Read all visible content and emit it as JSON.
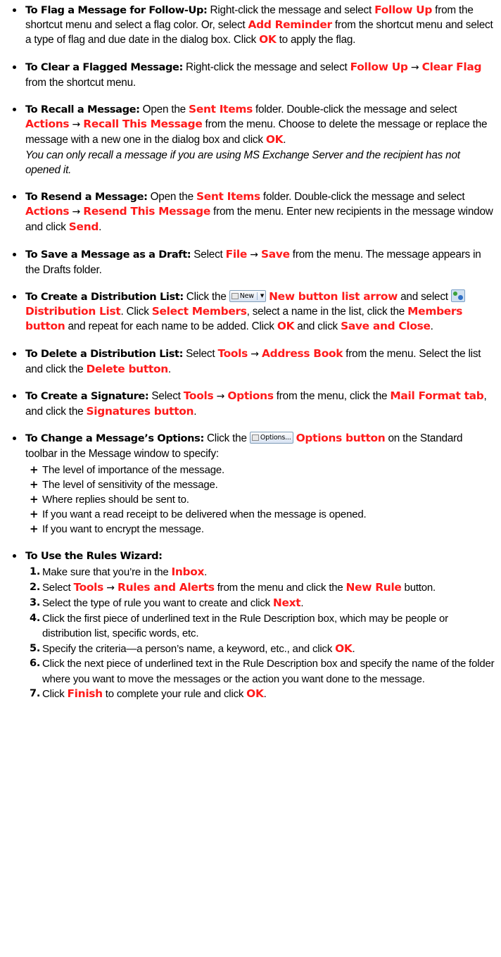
{
  "colors": {
    "highlight": "#ff1a1a",
    "text": "#000000"
  },
  "tips": {
    "flag": {
      "title": "To Flag a Message for Follow-Up:",
      "t1": " Right-click the message and select ",
      "h1": "Follow Up",
      "t2": " from the shortcut menu and select a flag color. Or, select ",
      "h2": "Add Reminder",
      "t3": " from the shortcut menu and select a type of flag and due date in the dialog box. Click ",
      "h3": "OK",
      "t4": " to apply the flag."
    },
    "clear": {
      "title": "To Clear a Flagged Message:",
      "t1": " Right-click the message and select ",
      "h1": "Follow Up",
      "arrow": " → ",
      "h2": "Clear Flag",
      "t2": " from the shortcut menu."
    },
    "recall": {
      "title": "To Recall a Message:",
      "t1": " Open the ",
      "h1": "Sent Items",
      "t2": " folder. Double-click the message and select ",
      "h2": "Actions",
      "arrow": " → ",
      "h3": "Recall This Message",
      "t3": " from the menu. Choose to delete the message or replace the message with a new one in the dialog box and click ",
      "h4": "OK",
      "t4": ".",
      "note": "You can only recall a message if you are using MS Exchange Server and the recipient has not opened it."
    },
    "resend": {
      "title": "To Resend a Message:",
      "t1": " Open the ",
      "h1": "Sent Items",
      "t2": " folder. Double-click the message and select ",
      "h2": "Actions",
      "arrow": " → ",
      "h3": "Resend This Message",
      "t3": " from the menu. Enter new recipients in the message window and click ",
      "h4": "Send",
      "t4": "."
    },
    "draft": {
      "title": "To Save a Message as a Draft:",
      "t1": " Select ",
      "h1": "File",
      "arrow": " → ",
      "h2": "Save",
      "t2": " from the menu. The message appears in the Drafts folder."
    },
    "createdl": {
      "title": "To Create a Distribution List:",
      "t1": " Click the ",
      "newbtn": "New",
      "h1": "New button list arrow",
      "t2": " and select ",
      "h2": "Distribution List",
      "t3": ". Click ",
      "h3": "Select Members",
      "t4": ", select a name in the list, click the ",
      "h4": "Members button",
      "t5": " and repeat for each name to be added. Click ",
      "h5": "OK",
      "t6": " and click ",
      "h6": "Save and Close",
      "t7": "."
    },
    "deletedl": {
      "title": "To Delete a Distribution List:",
      "t1": " Select ",
      "h1": "Tools",
      "arrow": " → ",
      "h2": "Address Book",
      "t2": " from the menu. Select the list and click the ",
      "h3": "Delete button",
      "t3": "."
    },
    "signature": {
      "title": "To Create a Signature:",
      "t1": " Select ",
      "h1": "Tools",
      "arrow": " → ",
      "h2": "Options",
      "t2": " from the menu, click the ",
      "h3": "Mail Format tab",
      "t3": ", and click the ",
      "h4": "Signatures button",
      "t4": "."
    },
    "options": {
      "title": "To Change a Message’s Options:",
      "t1": " Click the ",
      "optbtn": "Options...",
      "h1": "Options button",
      "t2": " on the Standard toolbar in the Message window to specify:",
      "items": [
        "The level of importance of the message.",
        "The level of sensitivity of the message.",
        "Where replies should be sent to.",
        "If you want a read receipt to be delivered when the message is opened.",
        "If you want to encrypt the message."
      ]
    },
    "rules": {
      "title": "To Use the Rules Wizard:",
      "s1": {
        "num": "1.",
        "t1": " Make sure that you’re in the ",
        "h1": "Inbox",
        "t2": "."
      },
      "s2": {
        "num": "2.",
        "t1": " Select ",
        "h1": "Tools",
        "arrow": " → ",
        "h2": "Rules and Alerts",
        "t2": " from the menu and click the ",
        "h3": "New Rule",
        "t3": " button."
      },
      "s3": {
        "num": "3.",
        "t1": " Select the type of rule you want to create and click ",
        "h1": "Next",
        "t2": "."
      },
      "s4": {
        "num": "4.",
        "t1": " Click the first piece of underlined text in the Rule Description box, which may be people or distribution list, specific words, etc."
      },
      "s5": {
        "num": "5.",
        "t1": " Specify the criteria—a person’s name, a keyword, etc., and click ",
        "h1": "OK",
        "t2": "."
      },
      "s6": {
        "num": "6.",
        "t1": " Click the next piece of underlined text in the Rule Description box and specify the name of the folder where you want to move the messages or the action you want done to the message."
      },
      "s7": {
        "num": "7.",
        "t1": " Click ",
        "h1": "Finish",
        "t2": " to complete your rule and click ",
        "h2": "OK",
        "t3": "."
      }
    }
  }
}
